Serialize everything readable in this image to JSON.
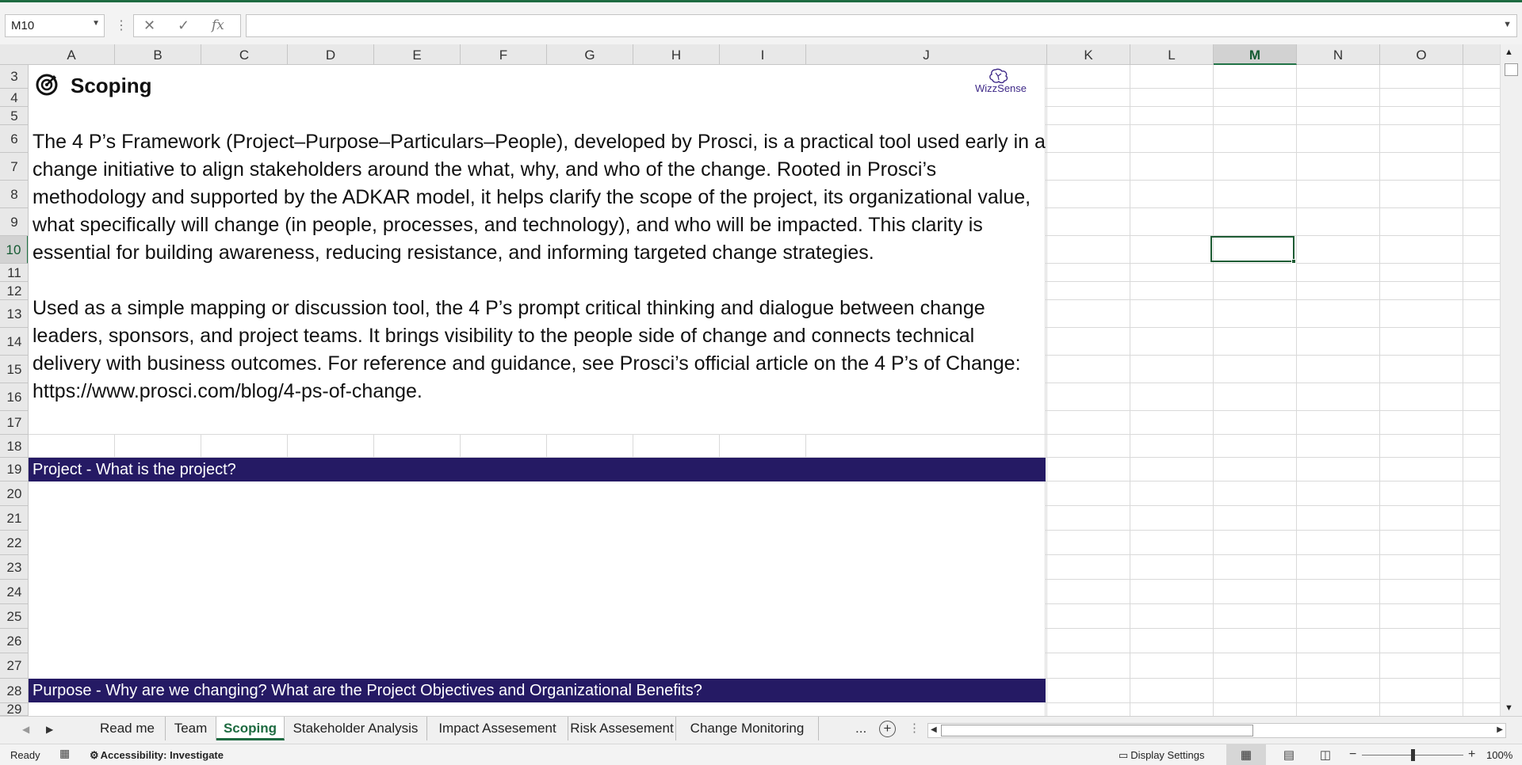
{
  "formula_bar": {
    "name_box": "M10",
    "formula": "",
    "cancel_icon": "✕",
    "enter_icon": "✓",
    "fx_icon": "fx"
  },
  "columns": [
    "A",
    "B",
    "C",
    "D",
    "E",
    "F",
    "G",
    "H",
    "I",
    "J",
    "K",
    "L",
    "M",
    "N",
    "O"
  ],
  "selected_column": "M",
  "rows": [
    "3",
    "4",
    "5",
    "6",
    "7",
    "8",
    "9",
    "10",
    "11",
    "12",
    "13",
    "14",
    "15",
    "16",
    "17",
    "18",
    "19",
    "20",
    "21",
    "22",
    "23",
    "24",
    "25",
    "26",
    "27",
    "28",
    "29"
  ],
  "selected_row": "10",
  "sheet": {
    "title": "Scoping",
    "title_icon": "target-gear-icon",
    "logo": {
      "text": "WizzSense",
      "icon": "brain-icon"
    },
    "paragraph_1": "The 4 P’s Framework (Project–Purpose–Particulars–People), developed by Prosci, is a practical tool used early in a change initiative to align stakeholders around the what, why, and who of the change. Rooted in Prosci’s methodology and supported by the ADKAR model, it helps clarify the scope of the project, its organizational value, what specifically will change (in people, processes, and technology), and who will be impacted. This clarity is essential for building awareness, reducing resistance, and informing targeted change strategies.",
    "paragraph_2": "Used as a simple mapping or discussion tool, the 4 P’s prompt critical thinking and dialogue between change leaders, sponsors, and project teams. It brings visibility to the people side of change and connects technical delivery with business outcomes. For reference and guidance, see Prosci’s official article on the 4 P’s of Change: https://www.prosci.com/blog/4-ps-of-change.",
    "band_project": "Project - What is the project?",
    "band_purpose": "Purpose - Why are we changing? What are the Project Objectives and Organizational Benefits?",
    "band_color": "#251a64"
  },
  "tabs": [
    {
      "label": "Read me"
    },
    {
      "label": "Team"
    },
    {
      "label": "Scoping",
      "active": true
    },
    {
      "label": "Stakeholder Analysis"
    },
    {
      "label": "Impact Assesement"
    },
    {
      "label": "Risk Assesement"
    },
    {
      "label": "Change Monitoring"
    }
  ],
  "tabs_more": "...",
  "status_bar": {
    "ready": "Ready",
    "accessibility": "Accessibility: Investigate",
    "display_settings": "Display Settings",
    "zoom": "100%",
    "zoom_fraction": 0.5
  },
  "accent_color": "#1e6b41"
}
